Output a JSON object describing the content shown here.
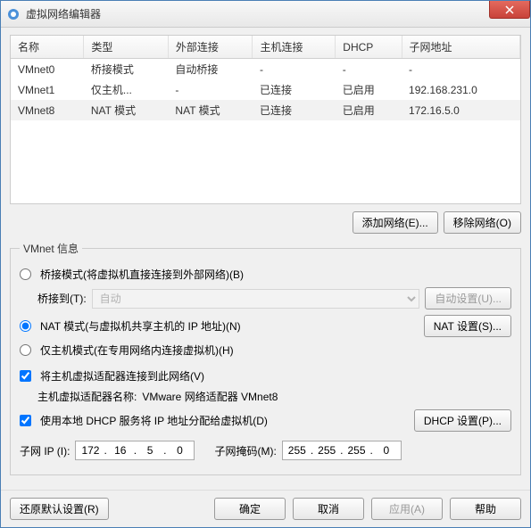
{
  "window": {
    "title": "虚拟网络编辑器"
  },
  "table": {
    "headers": [
      "名称",
      "类型",
      "外部连接",
      "主机连接",
      "DHCP",
      "子网地址"
    ],
    "rows": [
      {
        "cells": [
          "VMnet0",
          "桥接模式",
          "自动桥接",
          "-",
          "-",
          "-"
        ],
        "selected": false
      },
      {
        "cells": [
          "VMnet1",
          "仅主机...",
          "-",
          "已连接",
          "已启用",
          "192.168.231.0"
        ],
        "selected": false
      },
      {
        "cells": [
          "VMnet8",
          "NAT 模式",
          "NAT 模式",
          "已连接",
          "已启用",
          "172.16.5.0"
        ],
        "selected": true
      }
    ]
  },
  "buttons": {
    "add_net": "添加网络(E)...",
    "remove_net": "移除网络(O)",
    "auto_settings": "自动设置(U)...",
    "nat_settings": "NAT 设置(S)...",
    "dhcp_settings": "DHCP 设置(P)...",
    "restore": "还原默认设置(R)",
    "ok": "确定",
    "cancel": "取消",
    "apply": "应用(A)",
    "help": "帮助"
  },
  "info": {
    "legend": "VMnet 信息",
    "bridge_radio": "桥接模式(将虚拟机直接连接到外部网络)(B)",
    "bridge_to_label": "桥接到(T):",
    "bridge_to_value": "自动",
    "nat_radio": "NAT 模式(与虚拟机共享主机的 IP 地址)(N)",
    "hostonly_radio": "仅主机模式(在专用网络内连接虚拟机)(H)",
    "host_adapter_chk": "将主机虚拟适配器连接到此网络(V)",
    "host_adapter_name_label": "主机虚拟适配器名称:",
    "host_adapter_name_value": "VMware 网络适配器 VMnet8",
    "dhcp_chk": "使用本地 DHCP 服务将 IP 地址分配给虚拟机(D)",
    "subnet_ip_label": "子网 IP (I):",
    "subnet_ip": [
      "172",
      "16",
      "5",
      "0"
    ],
    "subnet_mask_label": "子网掩码(M):",
    "subnet_mask": [
      "255",
      "255",
      "255",
      "0"
    ]
  }
}
